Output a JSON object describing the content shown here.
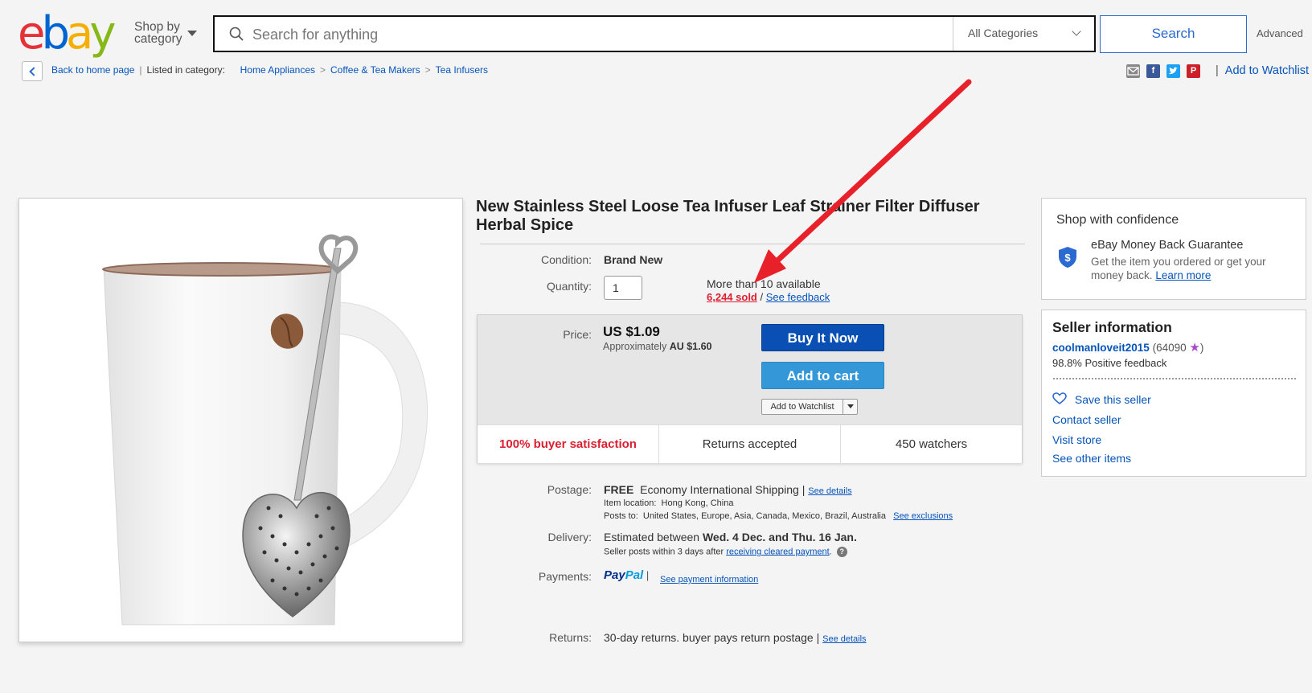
{
  "header": {
    "logo_letters": [
      "e",
      "b",
      "a",
      "y"
    ],
    "logo_colors": [
      "#e53238",
      "#0064d2",
      "#f5af02",
      "#86b817"
    ],
    "shop_by_line1": "Shop by",
    "shop_by_line2": "category",
    "search_placeholder": "Search for anything",
    "category_select": "All Categories",
    "search_button": "Search",
    "advanced_link": "Advanced"
  },
  "breadcrumb": {
    "back_label": "Back to home page",
    "listed_in": "Listed in category:",
    "items": [
      "Home Appliances",
      "Coffee & Tea Makers",
      "Tea Infusers"
    ],
    "separator": ">"
  },
  "share": {
    "icons": [
      "email-icon",
      "facebook-icon",
      "twitter-icon",
      "pinterest-icon"
    ],
    "add_to_watchlist": "Add to Watchlist"
  },
  "item": {
    "title": "New Stainless Steel Loose Tea Infuser Leaf Strainer Filter Diffuser Herbal Spice",
    "condition_label": "Condition:",
    "condition_value": "Brand New",
    "quantity_label": "Quantity:",
    "quantity_value": "1",
    "availability": "More than 10 available",
    "sold": "6,244 sold",
    "sold_sep": "/",
    "see_feedback": "See feedback",
    "price_label": "Price:",
    "price": "US $1.09",
    "approx_prefix": "Approximately",
    "approx_value": "AU $1.60",
    "buy_now": "Buy It Now",
    "add_to_cart": "Add to cart",
    "add_to_watchlist": "Add to Watchlist",
    "satisfaction": "100% buyer satisfaction",
    "returns_accepted": "Returns accepted",
    "watchers": "450 watchers"
  },
  "shipping": {
    "postage_label": "Postage:",
    "postage_free": "FREE",
    "postage_method": "Economy International Shipping |",
    "see_details": "See details",
    "item_location_label": "Item location:",
    "item_location": "Hong Kong, China",
    "posts_to_label": "Posts to:",
    "posts_to": "United States, Europe, Asia, Canada, Mexico, Brazil, Australia",
    "see_exclusions": "See exclusions",
    "delivery_label": "Delivery:",
    "delivery_prefix": "Estimated between",
    "delivery_dates": "Wed. 4 Dec. and Thu. 16 Jan.",
    "seller_posts": "Seller posts within 3 days after",
    "receiving_payment": "receiving cleared payment",
    "payments_label": "Payments:",
    "paypal_1": "Pay",
    "paypal_2": "Pal",
    "see_payment": "See payment information",
    "returns_label": "Returns:",
    "returns_text": "30-day returns. buyer pays return postage |",
    "returns_see_details": "See details"
  },
  "confidence": {
    "title": "Shop with confidence",
    "guarantee_title": "eBay Money Back Guarantee",
    "guarantee_text": "Get the item you ordered or get your money back.",
    "learn_more": "Learn more"
  },
  "seller": {
    "title": "Seller information",
    "name": "coolmanloveit2015",
    "score": "(64090",
    "score_close": ")",
    "feedback": "98.8% Positive feedback",
    "save_seller": "Save this seller",
    "contact": "Contact seller",
    "visit_store": "Visit store",
    "other_items": "See other items"
  },
  "colors": {
    "link": "#0654ba",
    "buy_now": "#0a4fb3",
    "add_to_cart": "#3498d8",
    "sold_red": "#dd1e31",
    "annotation_arrow": "#e8202a"
  }
}
